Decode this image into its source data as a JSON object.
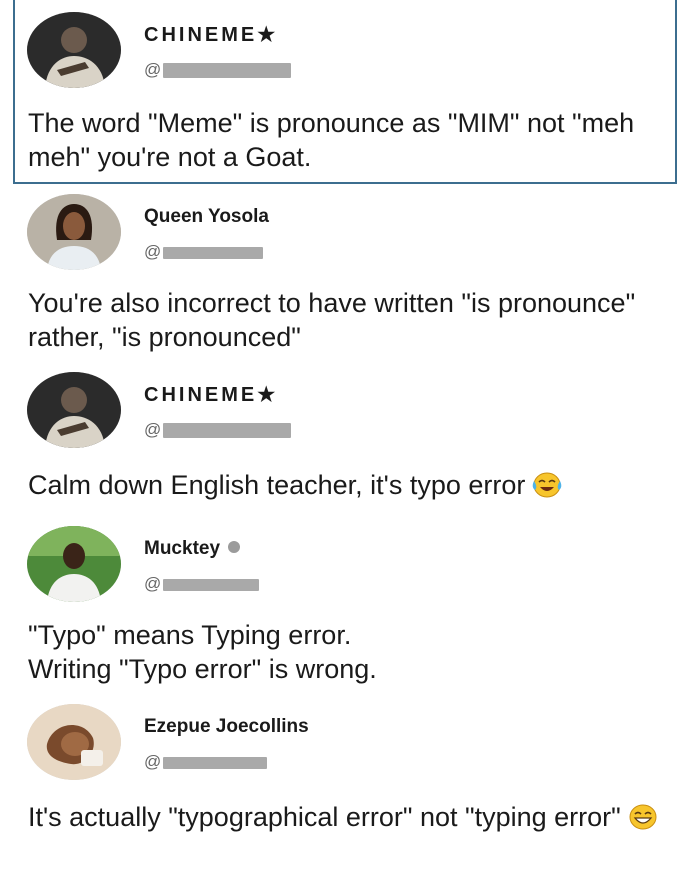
{
  "posts": [
    {
      "name": "CHINEME★",
      "handle_prefix": "@",
      "text": "The word \"Meme\" is pronounce as \"MIM\" not \"meh meh\" you're not a Goat.",
      "highlighted": true
    },
    {
      "name": "Queen Yosola",
      "handle_prefix": "@",
      "text": "You're also incorrect to have written \"is pronounce\" rather, \"is pronounced\""
    },
    {
      "name": "CHINEME★",
      "handle_prefix": "@",
      "text": "Calm down English teacher, it's typo error",
      "emoji": "face-with-tears-of-joy-icon"
    },
    {
      "name": "Mucktey",
      "handle_prefix": "@",
      "text": "\"Typo\" means Typing error.\nWriting \"Typo error\" is wrong."
    },
    {
      "name": "Ezepue Joecollins",
      "handle_prefix": "@",
      "text": "It's actually \"typographical error\" not \"typing error\"",
      "emoji": "grinning-face-icon"
    }
  ],
  "colors": {
    "highlight_border": "#3c6e8f",
    "handle": "#666666",
    "text": "#1a1a1a"
  }
}
